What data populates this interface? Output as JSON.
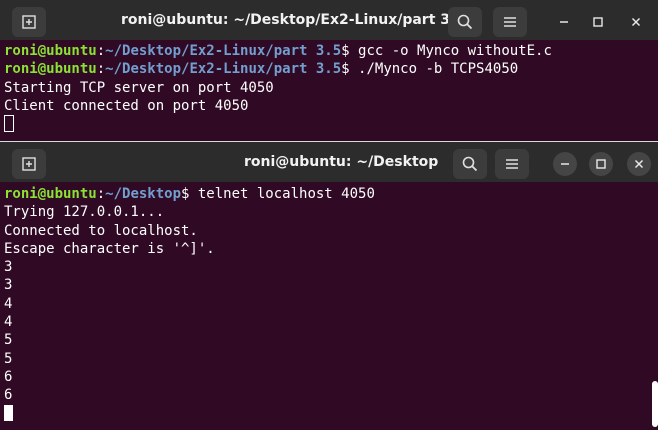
{
  "top_window": {
    "title": "roni@ubuntu: ~/Desktop/Ex2-Linux/part 3.5",
    "lines": [
      {
        "user": "roni@ubuntu",
        "colon": ":",
        "path": "~/Desktop/Ex2-Linux/part 3.5",
        "cmd": "$ gcc -o Mynco withoutE.c"
      },
      {
        "user": "roni@ubuntu",
        "colon": ":",
        "path": "~/Desktop/Ex2-Linux/part 3.5",
        "cmd": "$ ./Mynco -b TCPS4050"
      }
    ],
    "output": [
      "Starting TCP server on port 4050",
      "Client connected on port 4050"
    ]
  },
  "bottom_window": {
    "title": "roni@ubuntu: ~/Desktop",
    "prompt": {
      "user": "roni@ubuntu",
      "colon": ":",
      "path": "~/Desktop",
      "cmd": "$ telnet localhost 4050"
    },
    "output": [
      "Trying 127.0.0.1...",
      "Connected to localhost.",
      "Escape character is '^]'.",
      "3",
      "3",
      "4",
      "4",
      "5",
      "5",
      "6",
      "6"
    ]
  },
  "icons": {
    "new_tab": "new-tab-icon",
    "search": "search-icon",
    "menu": "hamburger-menu-icon",
    "minimize": "minimize-icon",
    "maximize": "maximize-icon",
    "close": "close-icon"
  },
  "colors": {
    "terminal_bg": "#300a24",
    "titlebar_bg": "#2c2c2c",
    "prompt_user": "#8ae234",
    "prompt_path": "#729fcf",
    "text": "#ffffff"
  }
}
